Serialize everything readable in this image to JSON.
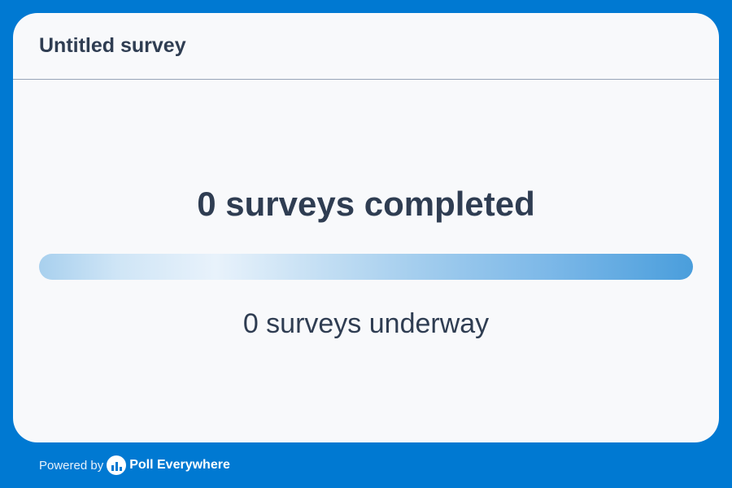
{
  "survey": {
    "title": "Untitled survey"
  },
  "stats": {
    "completed_text": "0 surveys completed",
    "underway_text": "0 surveys underway",
    "completed_count": 0,
    "underway_count": 0,
    "progress_fraction": 0
  },
  "footer": {
    "powered_by": "Powered by",
    "brand": "Poll Everywhere",
    "logo_icon": "poll-everywhere-logo-icon"
  },
  "colors": {
    "background": "#0079d2",
    "card": "#f8f9fb",
    "text": "#2f3d52"
  }
}
